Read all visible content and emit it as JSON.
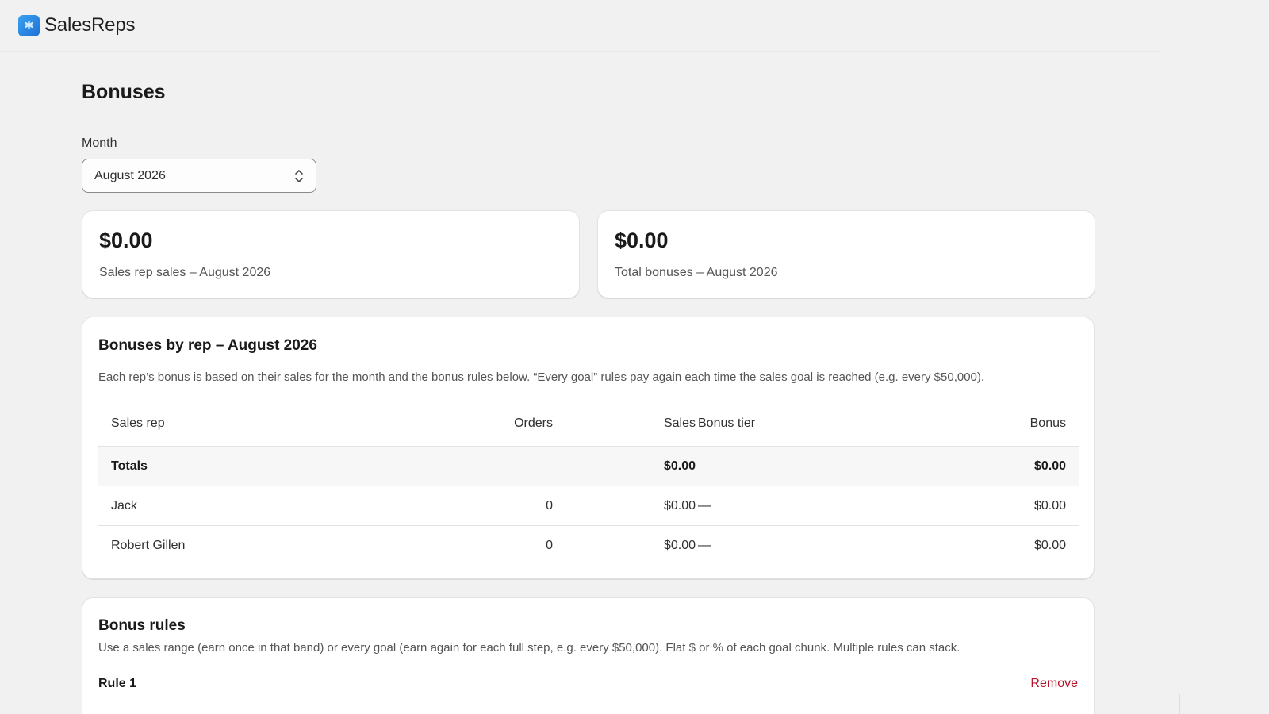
{
  "app": {
    "name": "SalesReps",
    "logo_icon": "sales-logo-icon"
  },
  "page": {
    "title": "Bonuses"
  },
  "month": {
    "label": "Month",
    "selected": "August 2026"
  },
  "stats": [
    {
      "value": "$0.00",
      "caption": "Sales rep sales – August 2026"
    },
    {
      "value": "$0.00",
      "caption": "Total bonuses – August 2026"
    }
  ],
  "bonuses_by_rep": {
    "title": "Bonuses by rep – August 2026",
    "description": "Each rep’s bonus is based on their sales for the month and the bonus rules below. “Every goal” rules pay again each time the sales goal is reached (e.g. every $50,000).",
    "columns": {
      "rep": "Sales rep",
      "orders": "Orders",
      "sales": "Sales",
      "tier": "Bonus tier",
      "bonus": "Bonus"
    },
    "totals": {
      "label": "Totals",
      "sales": "$0.00",
      "bonus": "$0.00"
    },
    "rows": [
      {
        "rep": "Jack",
        "orders": "0",
        "sales": "$0.00",
        "tier": "—",
        "bonus": "$0.00"
      },
      {
        "rep": "Robert Gillen",
        "orders": "0",
        "sales": "$0.00",
        "tier": "—",
        "bonus": "$0.00"
      }
    ]
  },
  "bonus_rules": {
    "title": "Bonus rules",
    "description": "Use a sales range (earn once in that band) or every goal (earn again for each full step, e.g. every $50,000). Flat $ or % of each goal chunk. Multiple rules can stack.",
    "rule_label": "Rule 1",
    "remove_label": "Remove"
  }
}
